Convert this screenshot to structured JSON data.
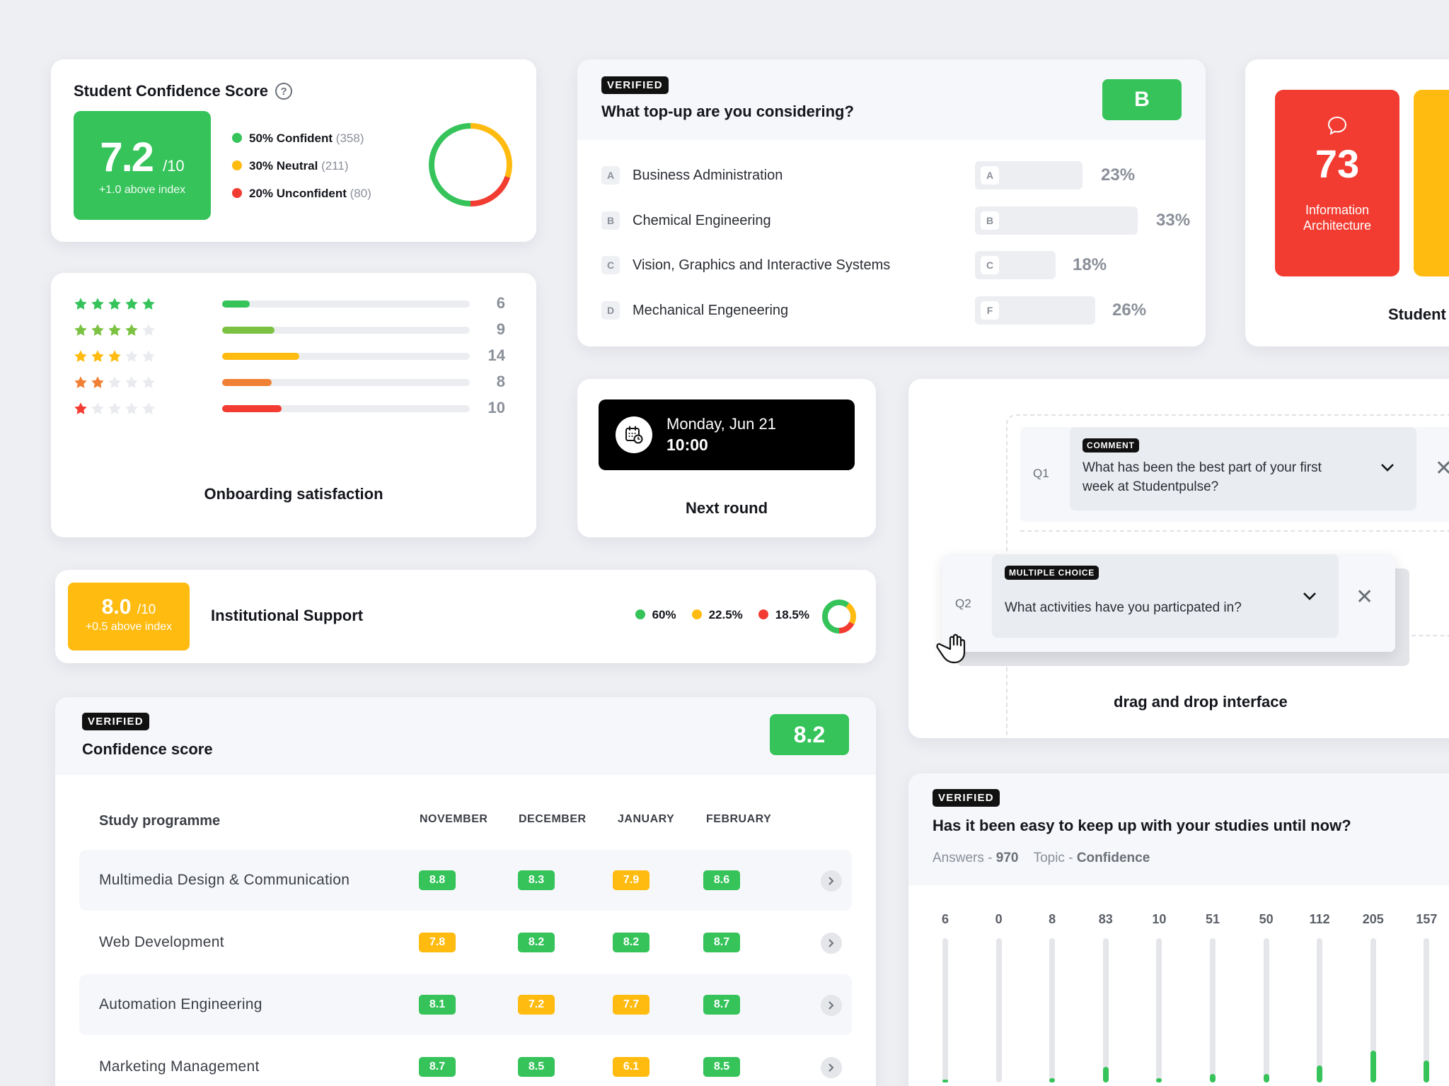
{
  "confidence_card": {
    "title": "Student Confidence Score",
    "help_glyph": "?",
    "score": "7.2",
    "score_out_of": "/10",
    "score_delta": "+1.0 above index",
    "legend": [
      {
        "label": "50% Confident",
        "count": "(358)",
        "color": "#35c35a",
        "share": 0.5
      },
      {
        "label": "30% Neutral",
        "count": "(211)",
        "color": "#ffbb10",
        "share": 0.3
      },
      {
        "label": "20% Unconfident",
        "count": "(80)",
        "color": "#f23c31",
        "share": 0.2
      }
    ]
  },
  "topup_card": {
    "badge": "VERIFIED",
    "question": "What top-up are you considering?",
    "answer_badge": "B",
    "options": [
      {
        "letter": "A",
        "label": "Business Administration",
        "bar_letter": "A",
        "pct": "23%",
        "value": 23
      },
      {
        "letter": "B",
        "label": "Chemical Engineering",
        "bar_letter": "B",
        "pct": "33%",
        "value": 33
      },
      {
        "letter": "C",
        "label": "Vision, Graphics and Interactive Systems",
        "bar_letter": "C",
        "pct": "18%",
        "value": 18
      },
      {
        "letter": "D",
        "label": "Mechanical Engeneering",
        "bar_letter": "F",
        "pct": "26%",
        "value": 26
      }
    ]
  },
  "student_card": {
    "count": "73",
    "category": "Information Architecture",
    "caption": "Student",
    "tile_color": "#f23c31",
    "tile2_color": "#ffbb10"
  },
  "stars_card": {
    "caption": "Onboarding satisfaction",
    "rows": [
      {
        "stars": 5,
        "color": "#35c35a",
        "count": "6",
        "fill": 0.11
      },
      {
        "stars": 4,
        "color": "#7cc242",
        "count": "9",
        "fill": 0.21
      },
      {
        "stars": 3,
        "color": "#ffbb10",
        "count": "14",
        "fill": 0.31
      },
      {
        "stars": 2,
        "color": "#f08034",
        "count": "8",
        "fill": 0.2
      },
      {
        "stars": 1,
        "color": "#f23c31",
        "count": "10",
        "fill": 0.24
      }
    ]
  },
  "next_round_card": {
    "date": "Monday, Jun 21",
    "time": "10:00",
    "caption": "Next round"
  },
  "dnd_card": {
    "q1": {
      "num": "Q1",
      "type": "COMMENT",
      "text": "What has been the best part of your first week at Studentpulse?"
    },
    "q2": {
      "num": "Q2",
      "type": "MULTIPLE CHOICE",
      "text": "What activities have you particpated in?"
    },
    "close_glyph": "✕",
    "caption": "drag and drop interface"
  },
  "institutional_card": {
    "score": "8.0",
    "score_out_of": "/10",
    "delta": "+0.5 above index",
    "title": "Institutional Support",
    "legend": [
      {
        "label": "60%",
        "color": "#35c35a",
        "share": 0.6
      },
      {
        "label": "22.5%",
        "color": "#ffbb10",
        "share": 0.225
      },
      {
        "label": "18.5%",
        "color": "#f23c31",
        "share": 0.185
      }
    ]
  },
  "table_card": {
    "badge": "VERIFIED",
    "title": "Confidence score",
    "score": "8.2",
    "columns": [
      "Study programme",
      "NOVEMBER",
      "DECEMBER",
      "JANUARY",
      "FEBRUARY"
    ],
    "rows": [
      {
        "name": "Multimedia Design & Communication",
        "values": [
          "8.8",
          "8.3",
          "7.9",
          "8.6"
        ],
        "status": [
          "g",
          "g",
          "y",
          "g"
        ]
      },
      {
        "name": "Web Development",
        "values": [
          "7.8",
          "8.2",
          "8.2",
          "8.7"
        ],
        "status": [
          "y",
          "g",
          "g",
          "g"
        ]
      },
      {
        "name": "Automation Engineering",
        "values": [
          "8.1",
          "7.2",
          "7.7",
          "8.7"
        ],
        "status": [
          "g",
          "y",
          "y",
          "g"
        ]
      },
      {
        "name": "Marketing Management",
        "values": [
          "8.7",
          "8.5",
          "6.1",
          "8.5"
        ],
        "status": [
          "g",
          "g",
          "y",
          "g"
        ]
      }
    ]
  },
  "studies_card": {
    "badge": "VERIFIED",
    "question": "Has it been easy to keep up with your studies until now?",
    "answers_label": "Answers - ",
    "answers_value": "970",
    "topic_label": "Topic - ",
    "topic_value": "Confidence",
    "columns": [
      {
        "value": "6",
        "fill": 0.02
      },
      {
        "value": "0",
        "fill": 0
      },
      {
        "value": "8",
        "fill": 0.03
      },
      {
        "value": "83",
        "fill": 0.11
      },
      {
        "value": "10",
        "fill": 0.03
      },
      {
        "value": "51",
        "fill": 0.06
      },
      {
        "value": "50",
        "fill": 0.06
      },
      {
        "value": "112",
        "fill": 0.12
      },
      {
        "value": "205",
        "fill": 0.22
      },
      {
        "value": "157",
        "fill": 0.15
      }
    ]
  }
}
